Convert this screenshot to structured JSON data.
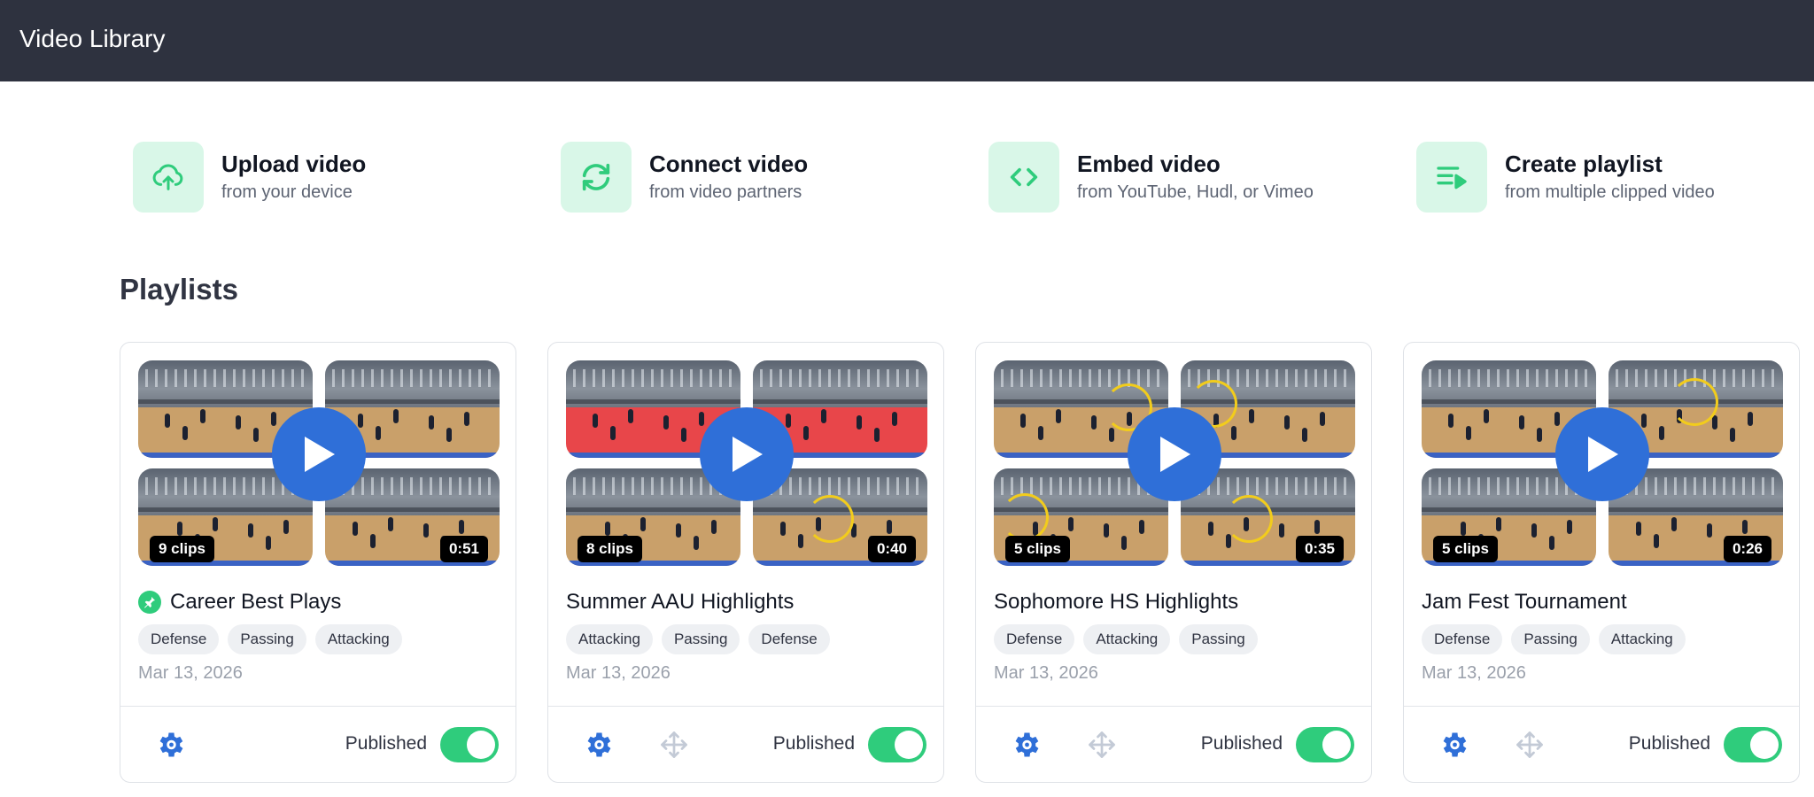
{
  "header": {
    "title": "Video Library"
  },
  "actions": [
    {
      "icon": "cloud-upload-icon",
      "title": "Upload video",
      "subtitle": "from your device"
    },
    {
      "icon": "sync-icon",
      "title": "Connect video",
      "subtitle": "from video partners"
    },
    {
      "icon": "code-icon",
      "title": "Embed video",
      "subtitle": "from YouTube, Hudl, or Vimeo"
    },
    {
      "icon": "playlist-add-icon",
      "title": "Create playlist",
      "subtitle": "from multiple clipped video"
    }
  ],
  "colors": {
    "header_bg": "#2e323f",
    "accent_green": "#2fcc7c",
    "accent_blue": "#2f6fd8",
    "icon_bg": "#d9f7e8"
  },
  "playlists_title": "Playlists",
  "playlists": [
    {
      "name": "Career Best Plays",
      "pinned": true,
      "clips": "9 clips",
      "duration": "0:51",
      "tags": [
        "Defense",
        "Passing",
        "Attacking"
      ],
      "date": "Mar 13, 2026",
      "status": "Published",
      "published": true
    },
    {
      "name": "Summer AAU Highlights",
      "pinned": false,
      "clips": "8 clips",
      "duration": "0:40",
      "tags": [
        "Attacking",
        "Passing",
        "Defense"
      ],
      "date": "Mar 13, 2026",
      "status": "Published",
      "published": true
    },
    {
      "name": "Sophomore HS Highlights",
      "pinned": false,
      "clips": "5 clips",
      "duration": "0:35",
      "tags": [
        "Defense",
        "Attacking",
        "Passing"
      ],
      "date": "Mar 13, 2026",
      "status": "Published",
      "published": true
    },
    {
      "name": "Jam Fest Tournament",
      "pinned": false,
      "clips": "5 clips",
      "duration": "0:26",
      "tags": [
        "Defense",
        "Passing",
        "Attacking"
      ],
      "date": "Mar 13, 2026",
      "status": "Published",
      "published": true
    }
  ]
}
